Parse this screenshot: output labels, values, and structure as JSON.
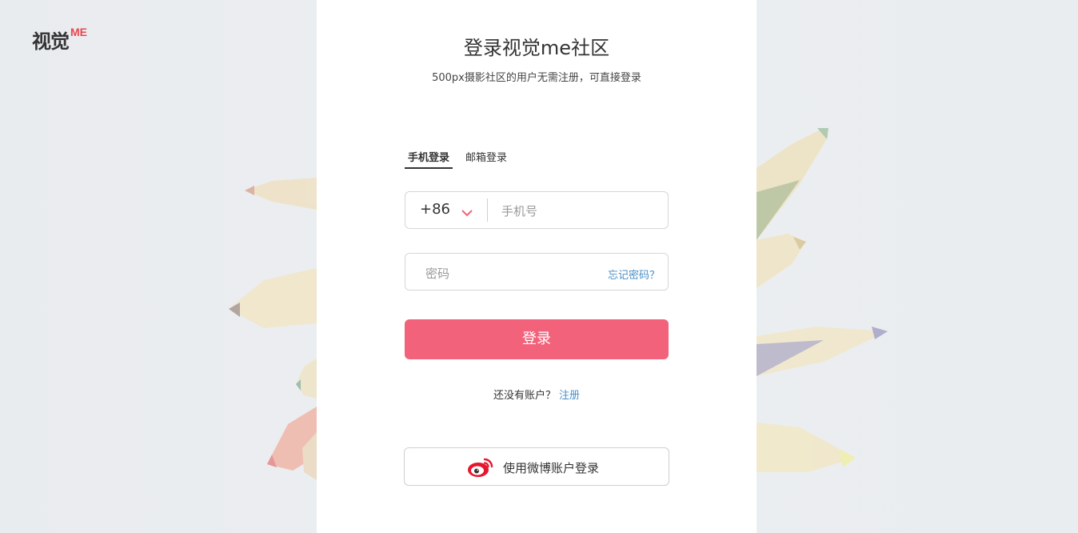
{
  "brand": {
    "logo_cn": "视觉",
    "logo_me": "ME"
  },
  "header": {
    "title": "登录视觉me社区",
    "subtitle": "500px摄影社区的用户无需注册，可直接登录"
  },
  "tabs": [
    {
      "label": "手机登录",
      "active": true
    },
    {
      "label": "邮箱登录",
      "active": false
    }
  ],
  "form": {
    "country_code": "+86",
    "phone_placeholder": "手机号",
    "password_placeholder": "密码",
    "forgot_label": "忘记密码？",
    "login_label": "登录"
  },
  "register": {
    "prompt": "还没有账户？",
    "link": "注册"
  },
  "weibo": {
    "label": "使用微博账户登录"
  },
  "colors": {
    "accent": "#f2637b",
    "link": "#4a90c8",
    "logo_red": "#e8474f",
    "weibo_red": "#e6162d"
  },
  "icons": {
    "country_dropdown": "chevron-down-icon",
    "weibo": "weibo-icon"
  }
}
